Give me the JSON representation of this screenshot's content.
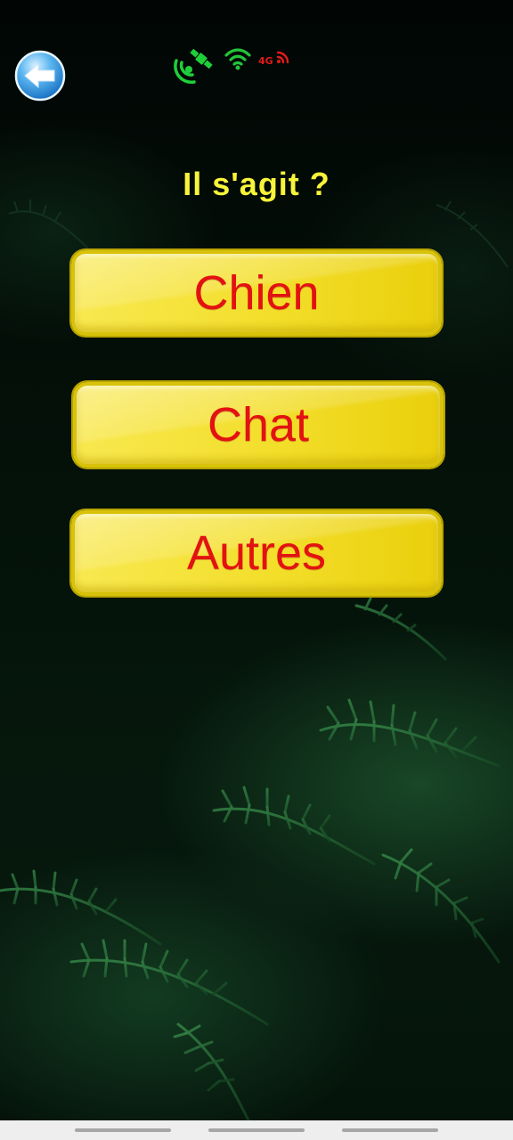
{
  "header": {
    "back_icon": "arrow-left-icon",
    "status_icons": {
      "gps_icon": "satellite-gps-icon",
      "wifi_icon": "wifi-icon",
      "cellular_icon": "cellular-signal-icon",
      "cellular_label": "4G"
    }
  },
  "quiz": {
    "question": "Il s'agit ?",
    "answers": [
      {
        "label": "Chien"
      },
      {
        "label": "Chat"
      },
      {
        "label": "Autres"
      }
    ]
  },
  "colors": {
    "question_text": "#f7f43a",
    "button_fill": "#f3de2a",
    "button_text": "#e31212",
    "gps_icon": "#1fcf3a",
    "wifi_icon": "#22c43a",
    "cellular_icon": "#e11a1a"
  }
}
